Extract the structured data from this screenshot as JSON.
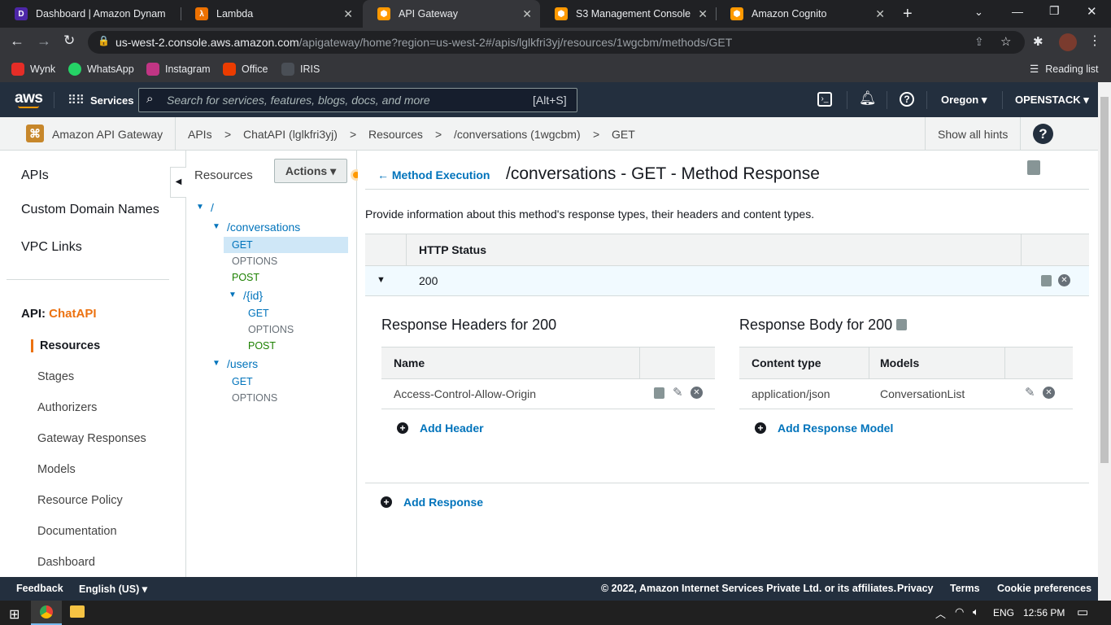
{
  "browser": {
    "tabs": [
      {
        "title": "Dashboard | Amazon Dynam",
        "icon": "dynamodb-icon",
        "color": "#4d27a8"
      },
      {
        "title": "Lambda",
        "icon": "lambda-icon",
        "color": "#ed7100"
      },
      {
        "title": "API Gateway",
        "icon": "api-gateway-icon",
        "color": "#ff9900"
      },
      {
        "title": "S3 Management Console",
        "icon": "s3-icon",
        "color": "#ff9900"
      },
      {
        "title": "Amazon Cognito",
        "icon": "cognito-icon",
        "color": "#ff9900"
      }
    ],
    "url_host": "us-west-2.console.aws.amazon.com",
    "url_path": "/apigateway/home?region=us-west-2#/apis/lglkfri3yj/resources/1wgcbm/methods/GET",
    "bookmarks": [
      "Wynk",
      "WhatsApp",
      "Instagram",
      "Office",
      "IRIS"
    ],
    "reading_list": "Reading list"
  },
  "aws_nav": {
    "logo": "aws",
    "services": "Services",
    "search_placeholder": "Search for services, features, blogs, docs, and more",
    "search_shortcut": "[Alt+S]",
    "region": "Oregon",
    "account": "OPENSTACK"
  },
  "breadcrumb": {
    "service": "Amazon API Gateway",
    "items": [
      "APIs",
      "ChatAPI (lglkfri3yj)",
      "Resources",
      "/conversations (1wgcbm)",
      "GET"
    ],
    "sep": ">",
    "hints": "Show all hints"
  },
  "left_nav": {
    "top": [
      "APIs",
      "Custom Domain Names",
      "VPC Links"
    ],
    "api_prefix": "API:",
    "api_name": "ChatAPI",
    "items": [
      "Resources",
      "Stages",
      "Authorizers",
      "Gateway Responses",
      "Models",
      "Resource Policy",
      "Documentation",
      "Dashboard"
    ]
  },
  "resources_panel": {
    "title": "Resources",
    "actions": "Actions",
    "tree": {
      "root": "/",
      "conversations": "/conversations",
      "conv_methods": [
        "GET",
        "OPTIONS",
        "POST"
      ],
      "id": "/{id}",
      "id_methods": [
        "GET",
        "OPTIONS",
        "POST"
      ],
      "users": "/users",
      "users_methods": [
        "GET",
        "OPTIONS"
      ]
    }
  },
  "main": {
    "back_link": "Method Execution",
    "title": "/conversations - GET - Method Response",
    "description": "Provide information about this method's response types, their headers and content types.",
    "status_header": "HTTP Status",
    "status_value": "200",
    "headers_title": "Response Headers for 200",
    "headers_col": "Name",
    "header_row": "Access-Control-Allow-Origin",
    "add_header": "Add Header",
    "body_title": "Response Body for 200",
    "body_cols": [
      "Content type",
      "Models"
    ],
    "body_row": [
      "application/json",
      "ConversationList"
    ],
    "add_model": "Add Response Model",
    "add_response": "Add Response"
  },
  "footer": {
    "feedback": "Feedback",
    "language": "English (US)",
    "copyright": "© 2022, Amazon Internet Services Private Ltd. or its affiliates.",
    "links": [
      "Privacy",
      "Terms",
      "Cookie preferences"
    ]
  },
  "taskbar": {
    "lang": "ENG",
    "time": "12:56 PM"
  }
}
